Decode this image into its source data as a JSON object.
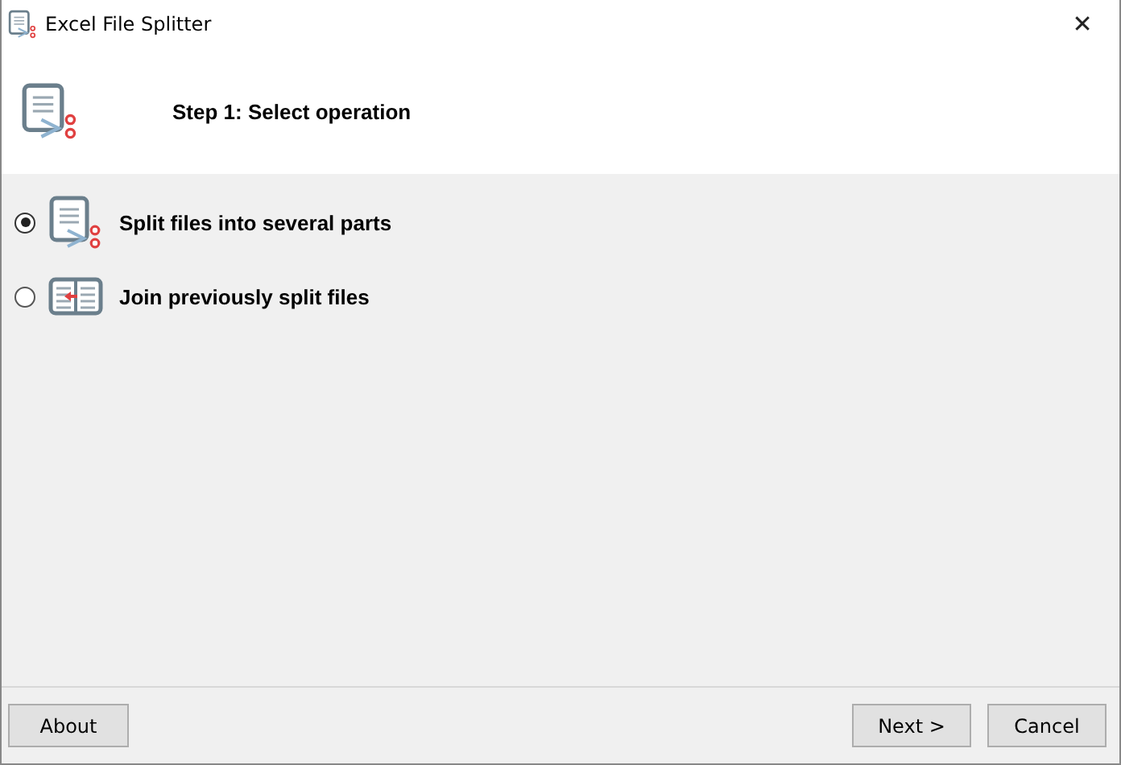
{
  "window": {
    "title": "Excel File Splitter",
    "close": "✕"
  },
  "header": {
    "title": "Step 1: Select operation"
  },
  "options": [
    {
      "label": "Split files into several parts",
      "kind": "split",
      "selected": true
    },
    {
      "label": "Join previously split files",
      "kind": "join",
      "selected": false
    }
  ],
  "buttons": {
    "left": [
      "About"
    ],
    "right": [
      "Next >",
      "Cancel"
    ]
  }
}
